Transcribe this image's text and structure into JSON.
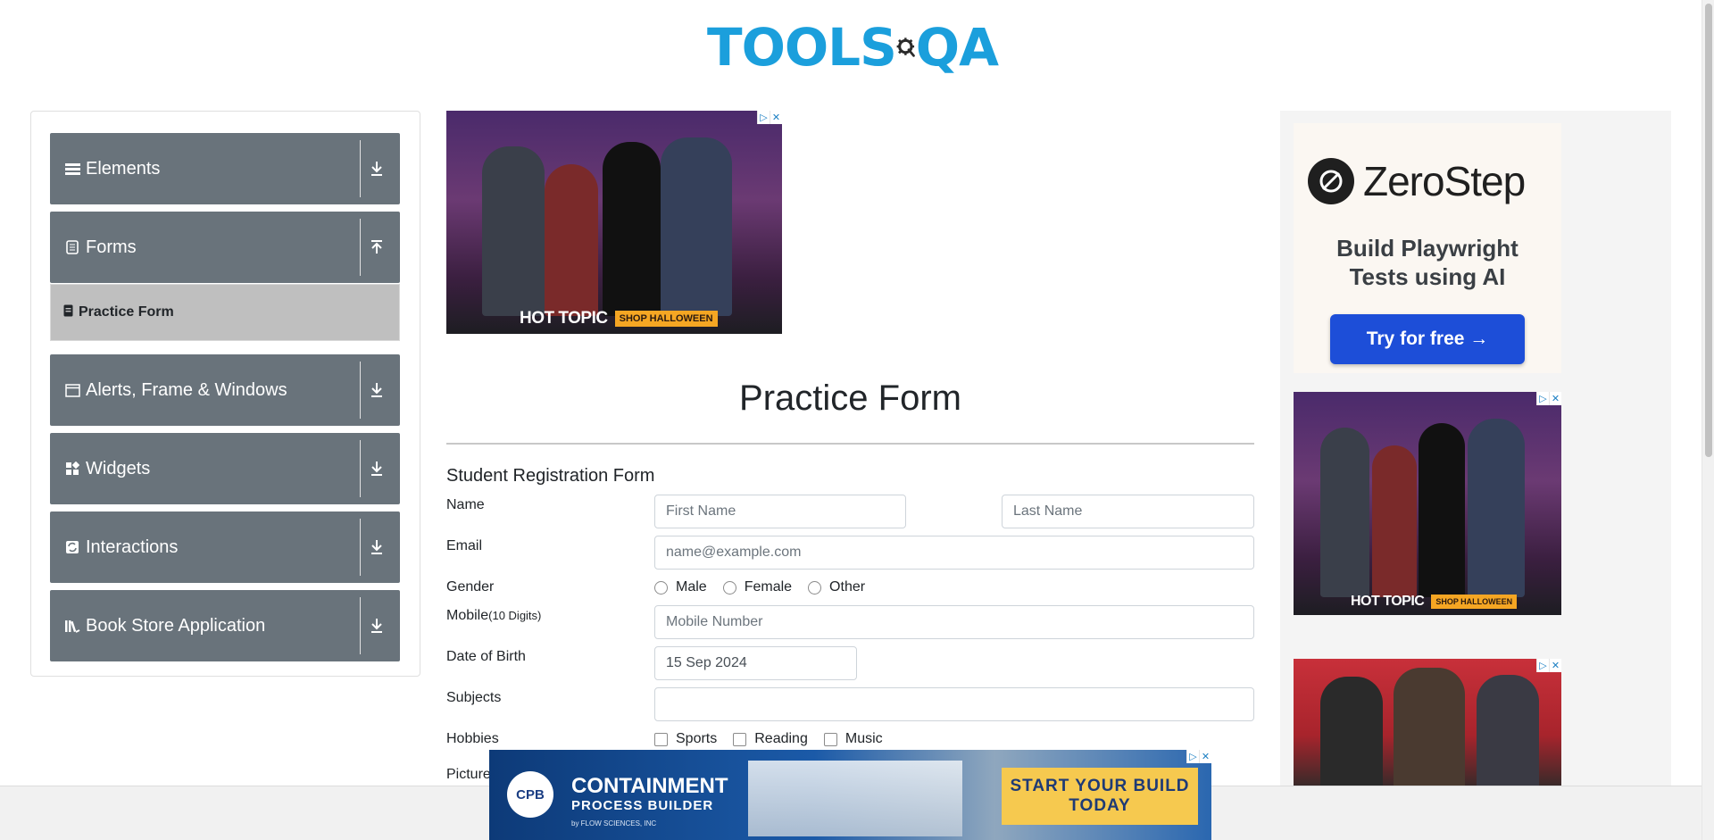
{
  "logo": {
    "part1": "TOOLS",
    "part2": "QA"
  },
  "sidebar": {
    "groups": [
      {
        "title": "Elements",
        "icon": "hamburger-icon",
        "arrow": "expand-icon"
      },
      {
        "title": "Forms",
        "icon": "form-icon",
        "arrow": "collapse-icon"
      },
      {
        "title": "Alerts, Frame & Windows",
        "icon": "window-icon",
        "arrow": "expand-icon"
      },
      {
        "title": "Widgets",
        "icon": "widgets-icon",
        "arrow": "expand-icon"
      },
      {
        "title": "Interactions",
        "icon": "interactions-icon",
        "arrow": "expand-icon"
      },
      {
        "title": "Book Store Application",
        "icon": "books-icon",
        "arrow": "expand-icon"
      }
    ],
    "active_item": "Practice Form"
  },
  "ads": {
    "hot_topic_brand": "HOT TOPIC",
    "hot_topic_cta": "SHOP HALLOWEEN",
    "zerostep_name": "ZeroStep",
    "zerostep_tagline_1": "Build Playwright",
    "zerostep_tagline_2": "Tests using AI",
    "zerostep_cta": "Try for free →",
    "cpb_logo": "CPB",
    "cpb_title_1": "CONTAINMENT",
    "cpb_title_2": "PROCESS BUILDER",
    "cpb_by": "by FLOW SCIENCES, INC",
    "cpb_cta": "START YOUR BUILD TODAY"
  },
  "form": {
    "page_title": "Practice Form",
    "subtitle": "Student Registration Form",
    "name_label": "Name",
    "first_name_placeholder": "First Name",
    "last_name_placeholder": "Last Name",
    "email_label": "Email",
    "email_placeholder": "name@example.com",
    "gender_label": "Gender",
    "gender_options": [
      "Male",
      "Female",
      "Other"
    ],
    "mobile_label": "Mobile",
    "mobile_hint": "(10 Digits)",
    "mobile_placeholder": "Mobile Number",
    "dob_label": "Date of Birth",
    "dob_value": "15 Sep 2024",
    "subjects_label": "Subjects",
    "subjects_value": "",
    "hobbies_label": "Hobbies",
    "hobbies_options": [
      "Sports",
      "Reading",
      "Music"
    ],
    "picture_label": "Picture"
  }
}
